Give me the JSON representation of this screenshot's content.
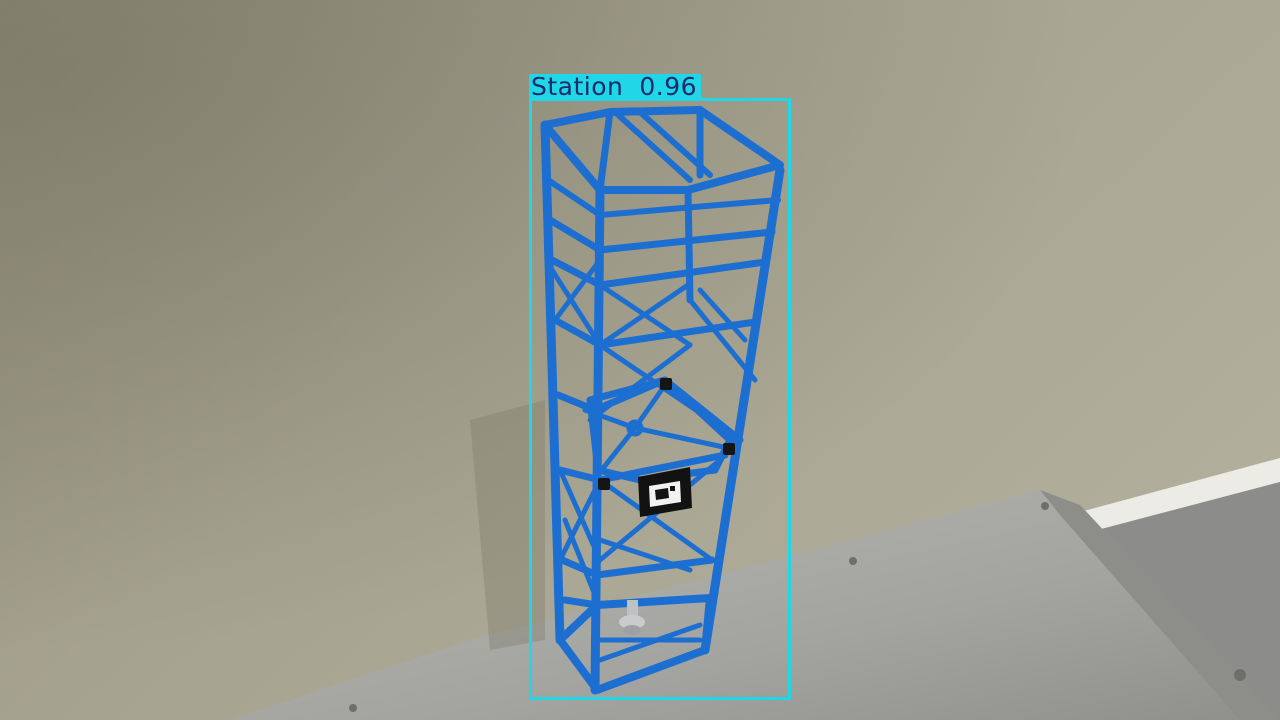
{
  "detection": {
    "class_label": "Station",
    "confidence": "0.96",
    "box_color": "#1fd7e6",
    "label_text_color": "#1b2a6b"
  },
  "scene": {
    "object_color": "#1c6fd0",
    "wall_color": "#a09c8a",
    "table_color": "#a7a8a4"
  }
}
